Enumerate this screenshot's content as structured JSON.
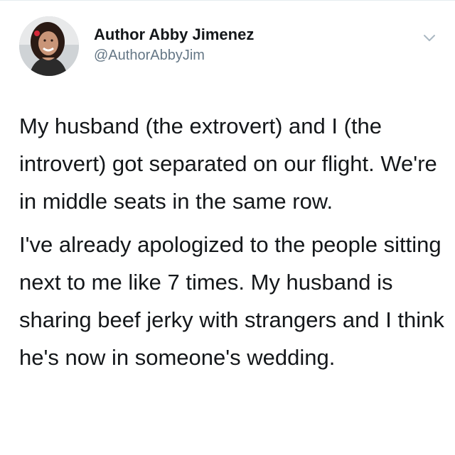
{
  "author": {
    "display_name": "Author Abby Jimenez",
    "handle": "@AuthorAbbyJim",
    "avatar_icon": "profile-photo"
  },
  "menu": {
    "icon": "chevron-down-icon"
  },
  "tweet": {
    "paragraphs": [
      "My husband (the extrovert) and I (the introvert) got separated on our flight. We're in middle seats in the same row.",
      "I've already apologized to the people sitting next to me like 7 times. My husband is sharing beef jerky with strangers and I think he's now in someone's wedding."
    ]
  },
  "colors": {
    "text": "#14171a",
    "secondary": "#657786",
    "divider": "#e6ecf0"
  }
}
